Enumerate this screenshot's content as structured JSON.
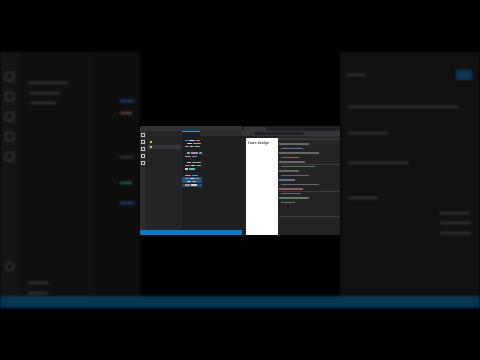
{
  "browser": {
    "page_text": "Hare bridge"
  },
  "colors": {
    "editor_bg": "#1e1e1e",
    "statusbar": "#007acc",
    "accent": "#3794ff",
    "page_bg": "#ffffff"
  },
  "icons": [
    "explorer-icon",
    "search-icon",
    "source-control-icon",
    "run-debug-icon",
    "extensions-icon"
  ]
}
